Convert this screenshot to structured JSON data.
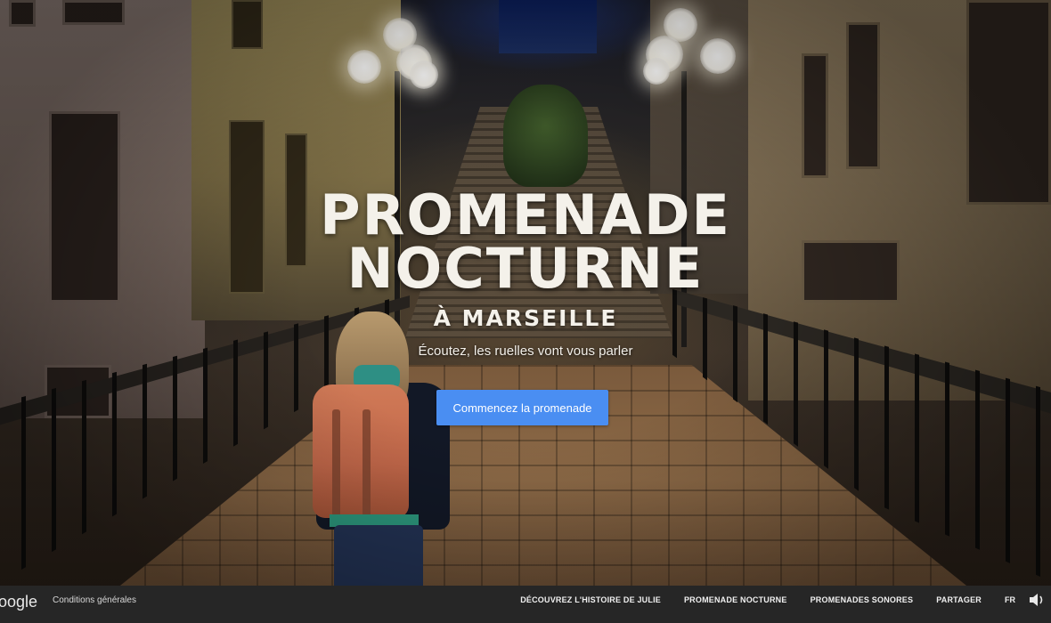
{
  "hero": {
    "title_line1": "PROMENADE",
    "title_line2": "NOCTURNE",
    "subtitle": "À MARSEILLE",
    "tagline": "Écoutez, les ruelles vont vous parler",
    "cta_label": "Commencez la promenade",
    "cta_color": "#4a8ef2"
  },
  "footer": {
    "logo": "oogle",
    "terms": "Conditions générales",
    "nav": [
      {
        "label": "DÉCOUVREZ L'HISTOIRE DE JULIE"
      },
      {
        "label": "PROMENADE NOCTURNE"
      },
      {
        "label": "PROMENADES SONORES"
      },
      {
        "label": "PARTAGER"
      }
    ],
    "language": "FR",
    "sound_icon": "speaker-icon"
  }
}
